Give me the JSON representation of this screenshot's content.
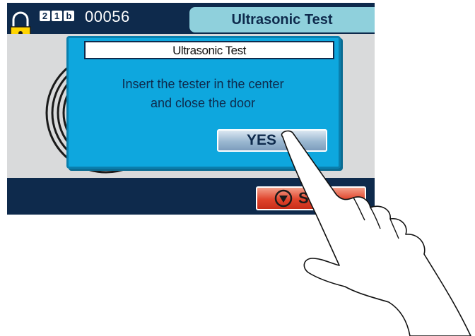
{
  "header": {
    "cycle_digits": [
      "2",
      "1",
      "b"
    ],
    "counter": "00056",
    "title": "Ultrasonic Test"
  },
  "dialog": {
    "title": "Ultrasonic Test",
    "message_line1": "Insert the tester in the center",
    "message_line2": "and close the door",
    "yes_label": "YES"
  },
  "footer": {
    "stop_label": "S"
  },
  "icons": [
    "lock-icon",
    "stop-icon",
    "hand-pointer-icon"
  ],
  "colors": {
    "background": "#0e2a4c",
    "dialog": "#0ea7de",
    "header_tab": "#8fd0dc",
    "stop_button": "#e0442c",
    "lock": "#ffd400"
  }
}
